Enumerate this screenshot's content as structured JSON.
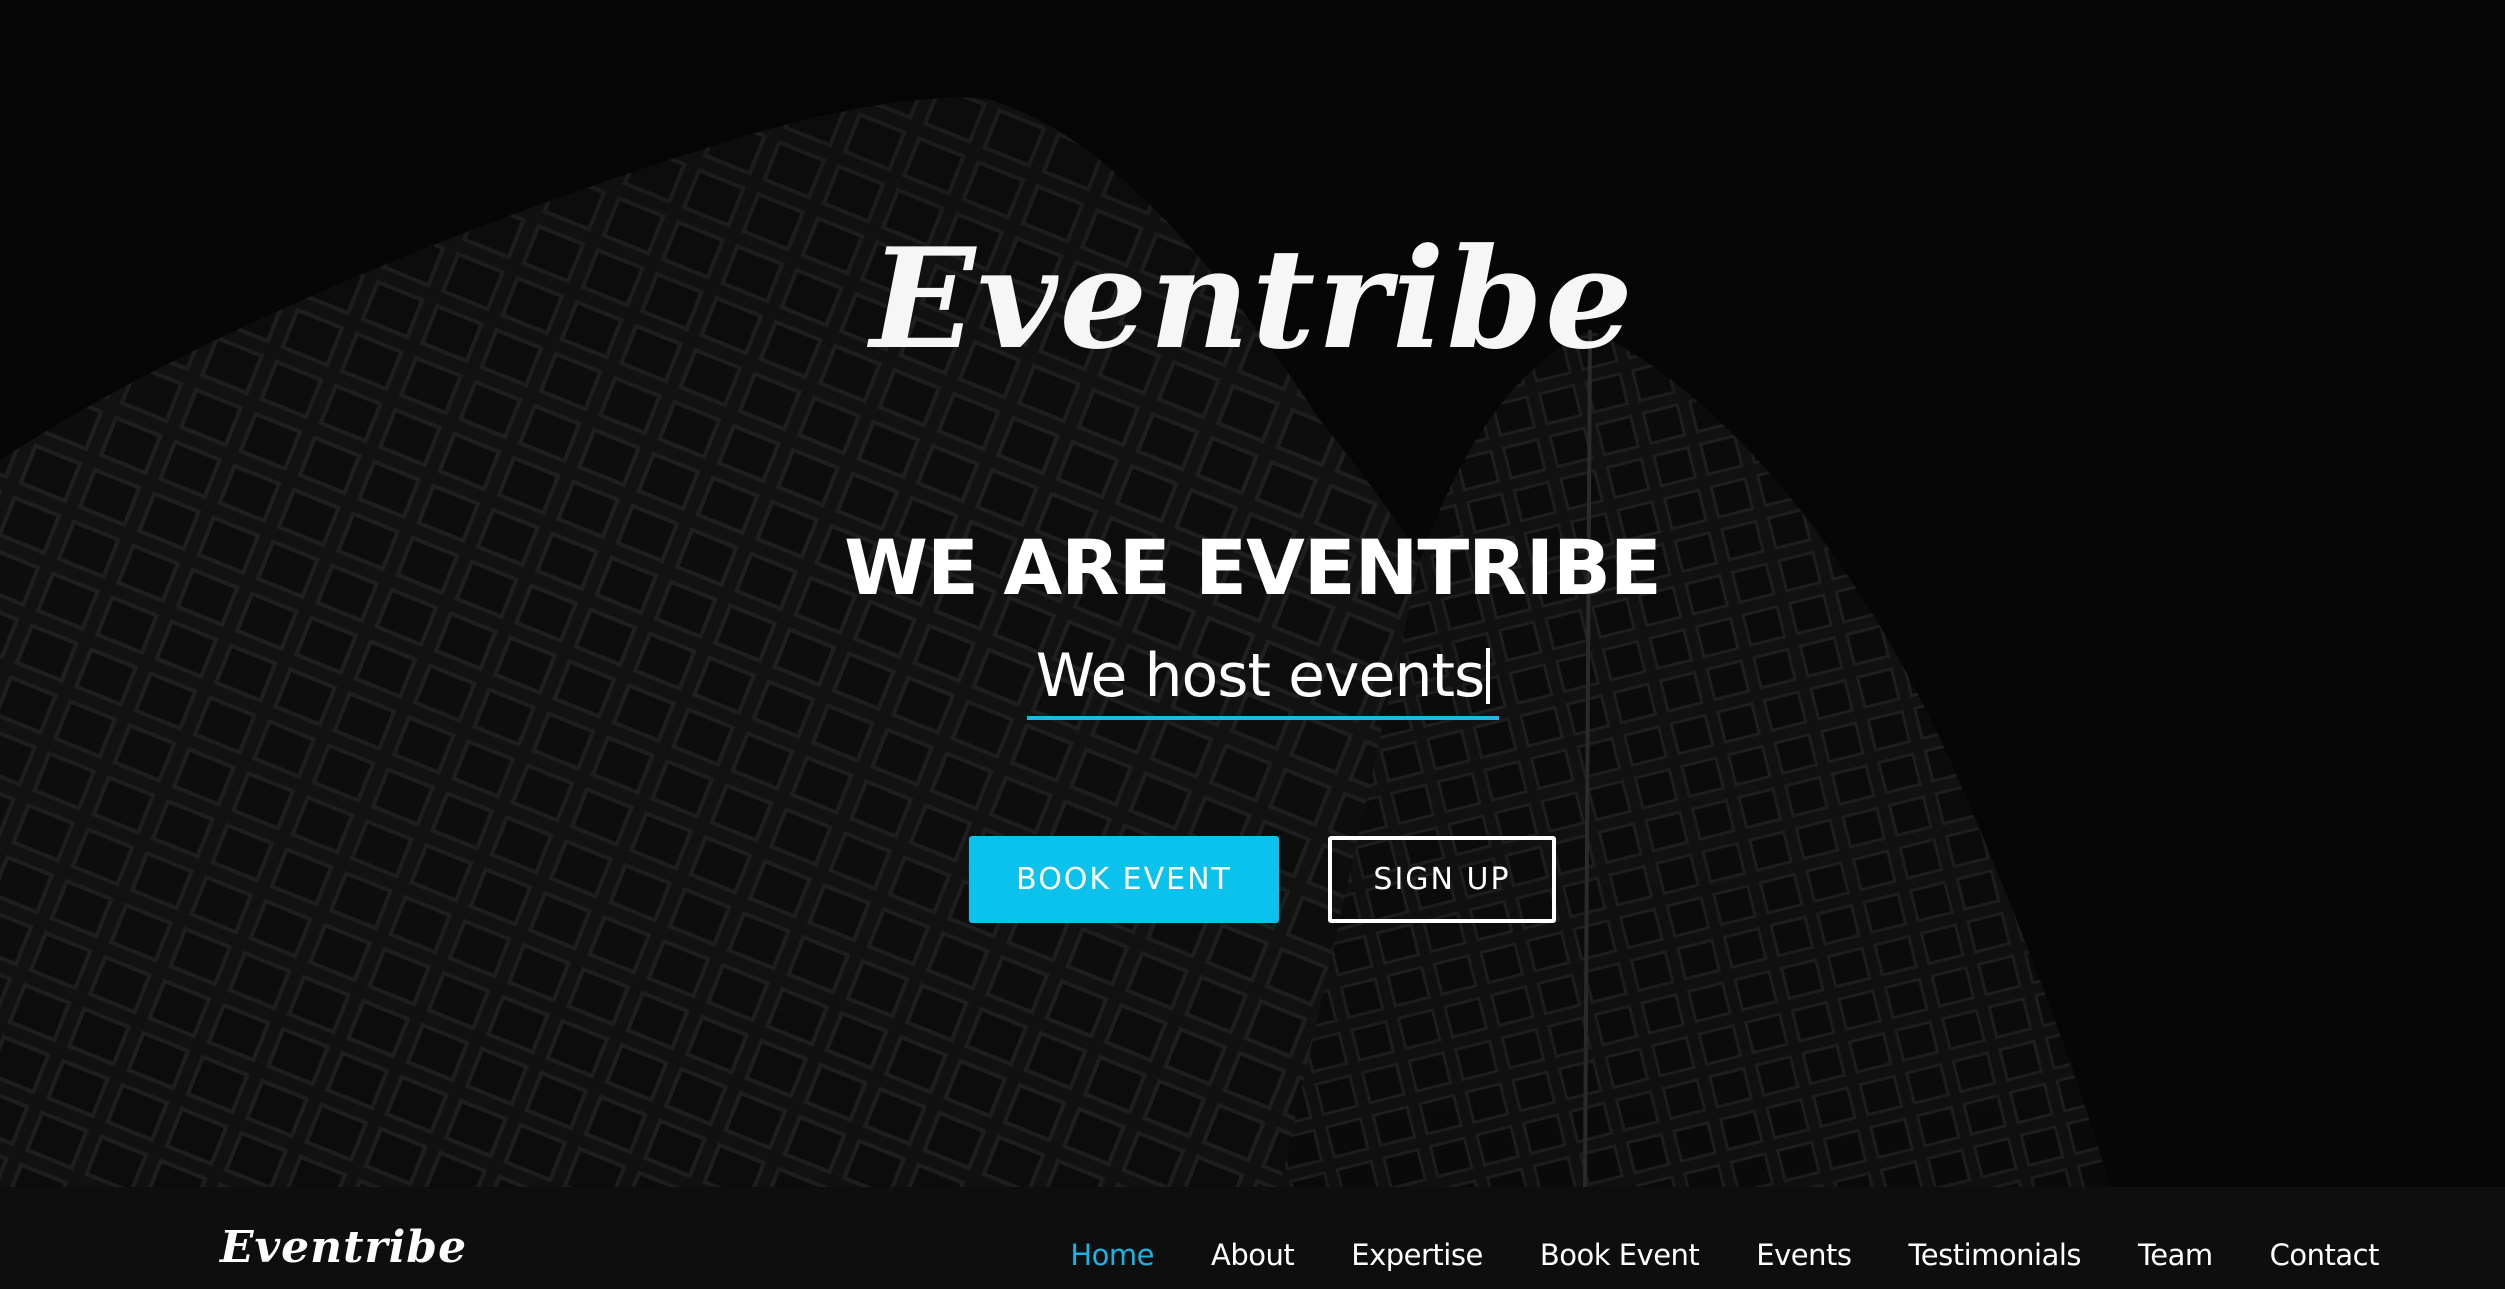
{
  "hero": {
    "logo": "Eventribe",
    "headline": "WE ARE EVENTRIBE",
    "typed_text": "We host events",
    "buttons": {
      "book_event": "BOOK EVENT",
      "sign_up": "SIGN UP"
    }
  },
  "navbar": {
    "logo": "Eventribe",
    "links": [
      {
        "label": "Home",
        "active": true
      },
      {
        "label": "About",
        "active": false
      },
      {
        "label": "Expertise",
        "active": false
      },
      {
        "label": "Book Event",
        "active": false
      },
      {
        "label": "Events",
        "active": false
      },
      {
        "label": "Testimonials",
        "active": false
      },
      {
        "label": "Team",
        "active": false
      },
      {
        "label": "Contact",
        "active": false
      }
    ]
  },
  "colors": {
    "accent": "#0ac2eb",
    "active_link": "#1ab3e3",
    "navbar_bg": "#0e0e0e",
    "hero_bg": "#080808"
  }
}
